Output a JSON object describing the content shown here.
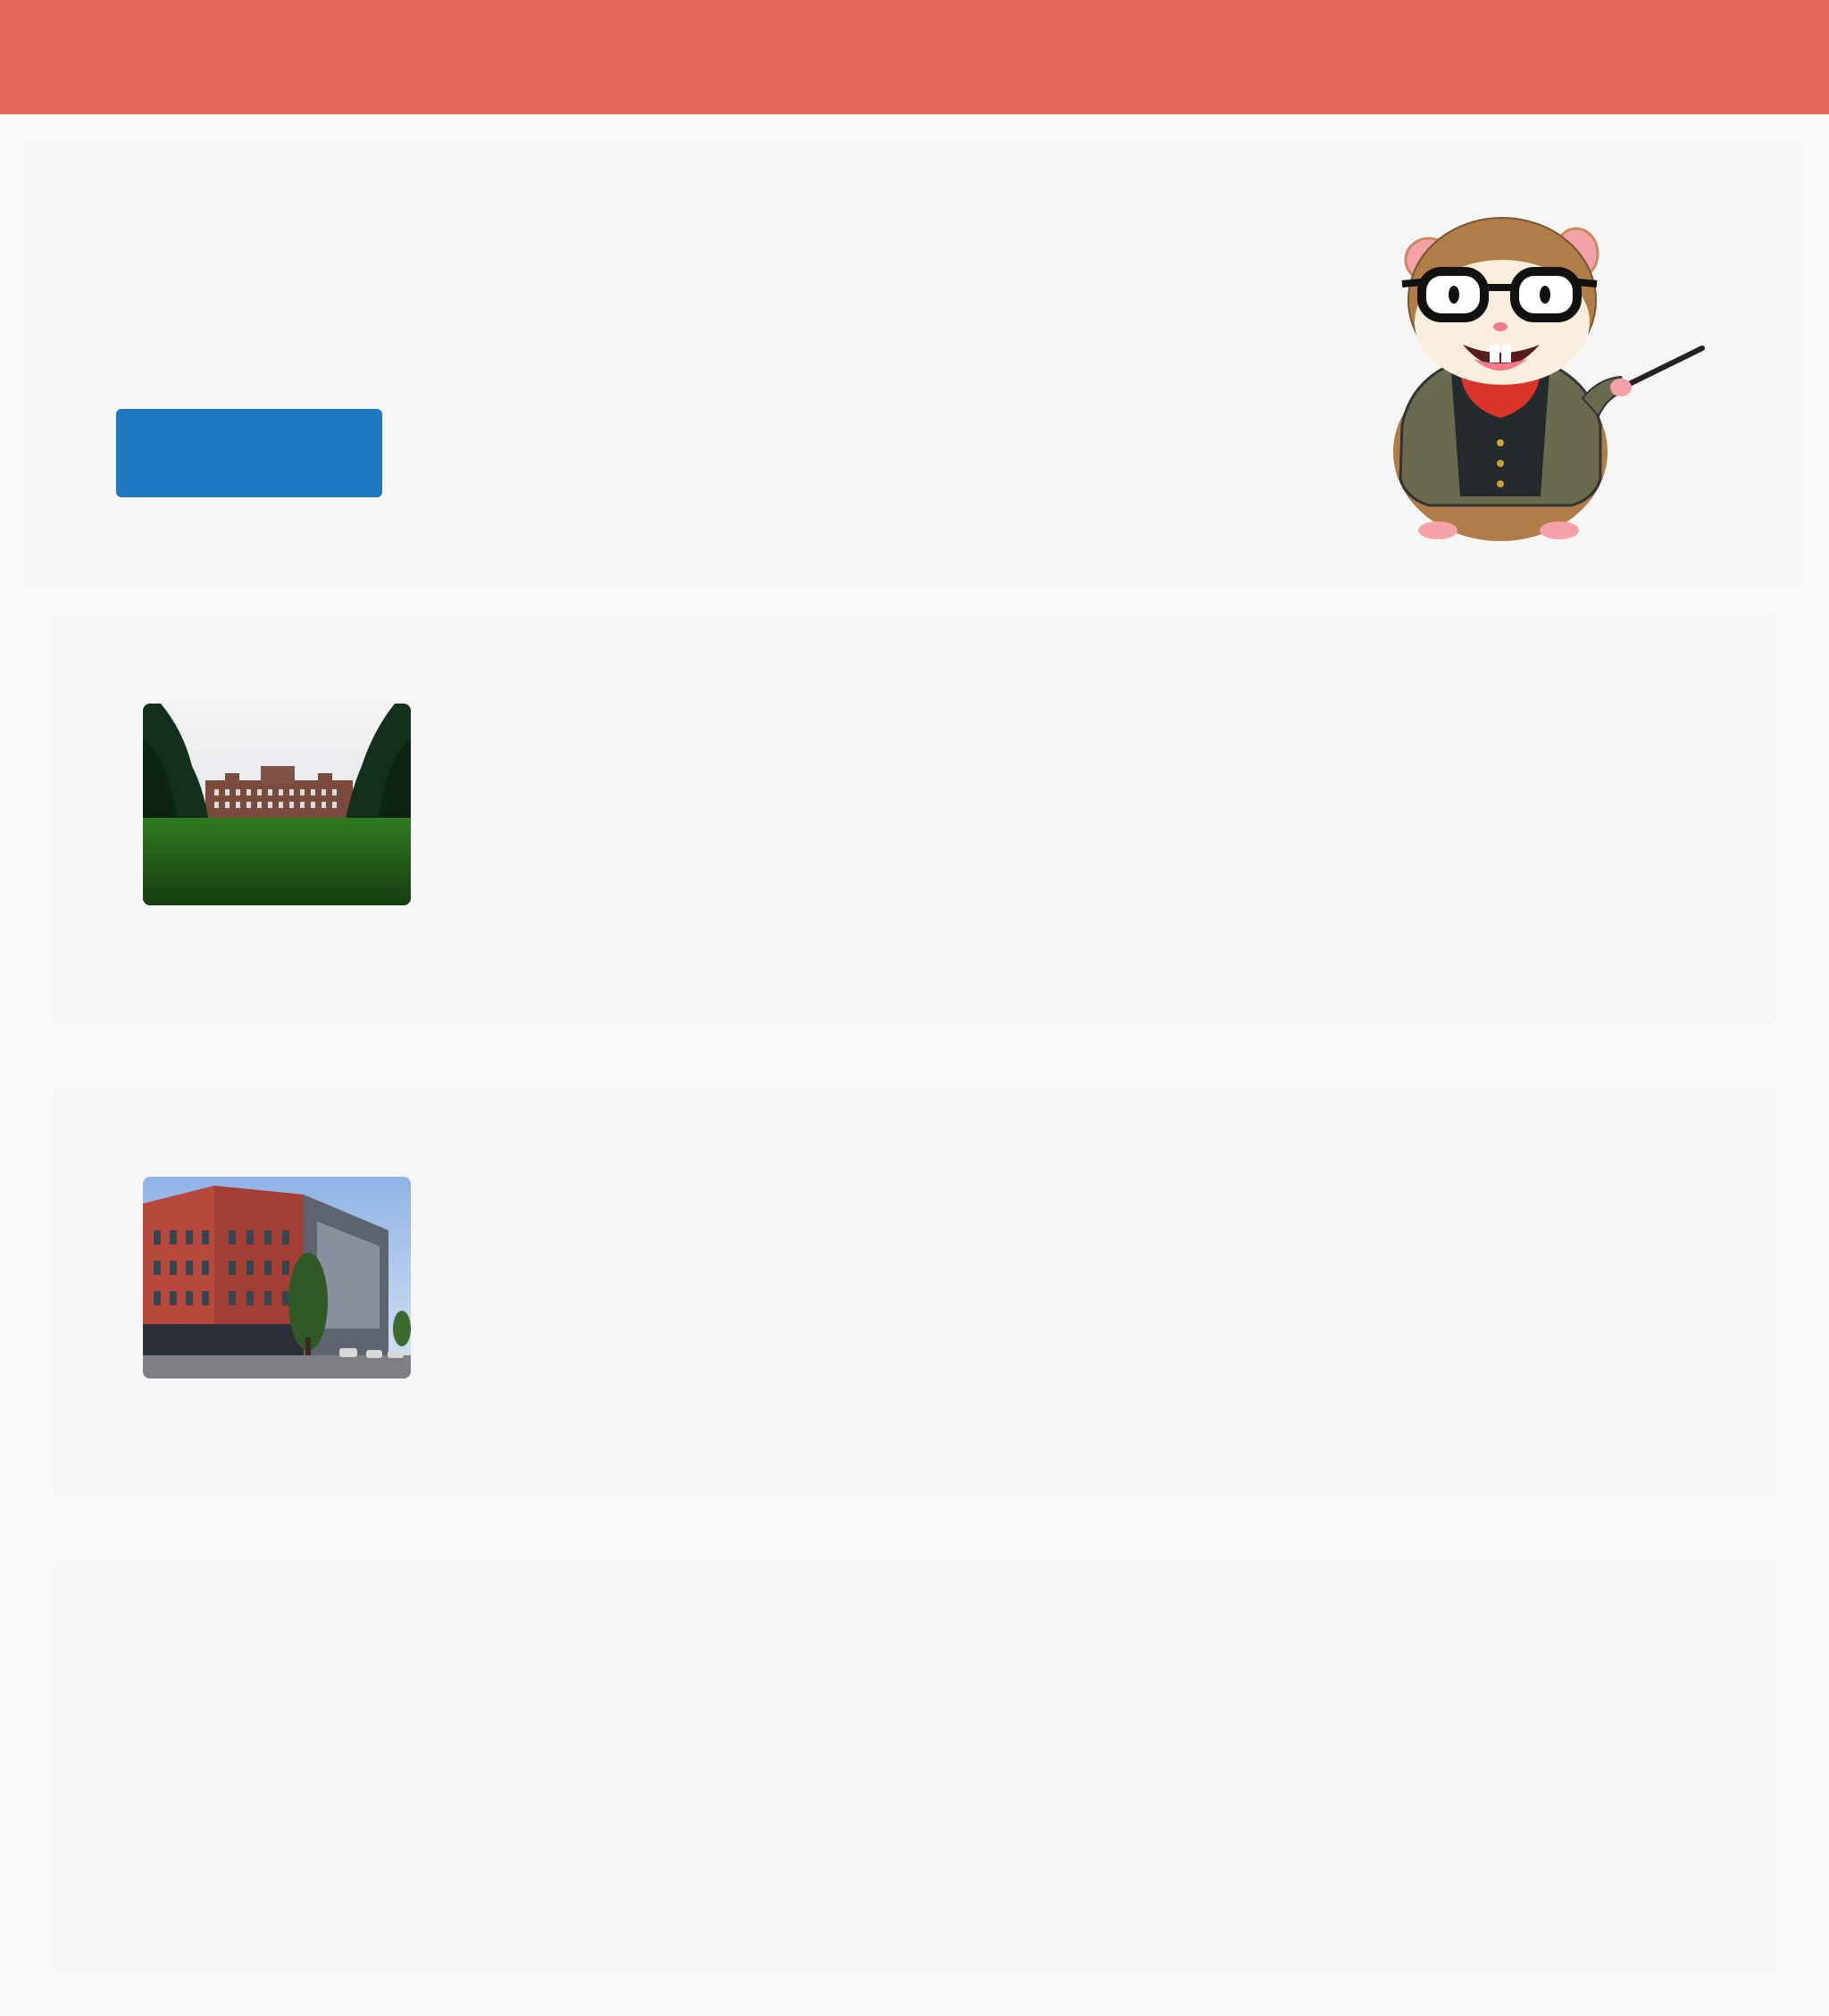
{
  "header": {
    "title": ""
  },
  "hero": {
    "button_label": "",
    "mascot_icon": "hamster-teacher-mascot-icon"
  },
  "listings": [
    {
      "image_icon": "mansion-lawn-photo"
    },
    {
      "image_icon": "brick-building-photo"
    },
    {
      "image_icon": ""
    }
  ],
  "colors": {
    "topbar": "#e66958",
    "button": "#1d79c1",
    "page_background": "#f9f9f9",
    "panel_background": "#f6f6f6"
  }
}
